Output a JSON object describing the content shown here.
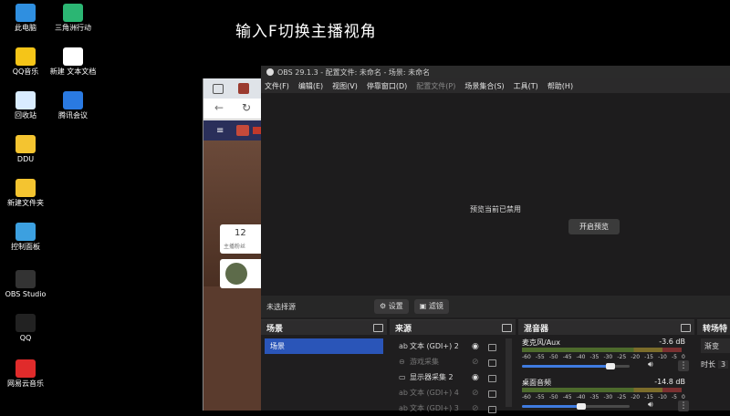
{
  "caption": "输入F切换主播视角",
  "desktop_icons": [
    {
      "label": "此电脑",
      "color": "#2f8fe0"
    },
    {
      "label": "三角洲行动",
      "color": "#2bb673"
    },
    {
      "label": "QQ音乐",
      "color": "#f5c518"
    },
    {
      "label": "新建 文本文档",
      "color": "#ffffff"
    },
    {
      "label": "回收站",
      "color": "#d9ecff"
    },
    {
      "label": "腾讯会议",
      "color": "#2a7ae2"
    },
    {
      "label": "DDU",
      "color": "#f4c430"
    },
    {
      "label": "新建文件夹",
      "color": "#f4c430"
    },
    {
      "label": "控制面板",
      "color": "#3ca0e0"
    },
    {
      "label": "OBS Studio",
      "color": "#333333"
    },
    {
      "label": "QQ",
      "color": "#222222"
    },
    {
      "label": "网易云音乐",
      "color": "#e02b2b"
    }
  ],
  "browser": {
    "card_number": "12",
    "card_text": "主播粉丝"
  },
  "obs": {
    "title": "OBS 29.1.3 - 配置文件: 未命名 - 场景: 未命名",
    "menu": [
      "文件(F)",
      "编辑(E)",
      "视图(V)",
      "停靠窗口(D)",
      "配置文件(P)",
      "场景集合(S)",
      "工具(T)",
      "帮助(H)"
    ],
    "preview_disabled": "预览当前已禁用",
    "enable_preview": "开启预览",
    "no_source": "未选择源",
    "settings_btn": "设置",
    "filters_btn": "滤镜",
    "docks": {
      "scenes": "场景",
      "sources": "来源",
      "mixer": "混音器",
      "transitions": "转场特"
    },
    "scene_items": [
      "场景"
    ],
    "sources": [
      {
        "icon": "ab",
        "name": "文本 (GDI+) 2",
        "visible": true
      },
      {
        "icon": "⊖",
        "name": "游戏采集",
        "visible": false
      },
      {
        "icon": "▭",
        "name": "显示器采集 2",
        "visible": true
      },
      {
        "icon": "ab",
        "name": "文本 (GDI+) 4",
        "visible": false
      },
      {
        "icon": "ab",
        "name": "文本 (GDI+) 3",
        "visible": false
      }
    ],
    "mixer": [
      {
        "name": "麦克风/Aux",
        "db": "-3.6 dB",
        "level": 0.82
      },
      {
        "name": "桌面音频",
        "db": "-14.8 dB",
        "level": 0.55
      }
    ],
    "meter_scale": [
      "-60",
      "-55",
      "-50",
      "-45",
      "-40",
      "-35",
      "-30",
      "-25",
      "-20",
      "-15",
      "-10",
      "-5",
      "0"
    ],
    "transitions": {
      "type": "渐变",
      "duration_label": "时长",
      "duration_value": "3"
    }
  }
}
